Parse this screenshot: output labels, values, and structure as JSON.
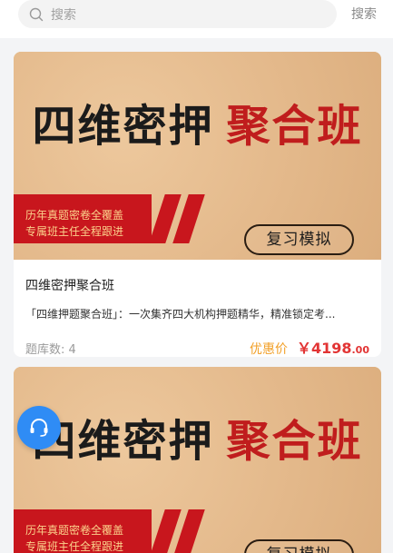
{
  "search": {
    "placeholder": "搜索",
    "button_label": "搜索"
  },
  "courses": [
    {
      "banner": {
        "title_main": "四维密押",
        "title_accent": "聚合班",
        "tag_line1": "历年真题密卷全覆盖",
        "tag_line2": "专属班主任全程跟进",
        "cta_label": "复习模拟"
      },
      "name": "四维密押聚合班",
      "description": "「四维押题聚合班」：一次集齐四大机构押题精华，精准锁定考...",
      "count_label": "题库数: 4",
      "price_label": "优惠价",
      "price_currency": "￥",
      "price_integer": "4198",
      "price_decimal": ".00"
    },
    {
      "banner": {
        "title_main": "四维密押",
        "title_accent": "聚合班",
        "tag_line1": "历年真题密卷全覆盖",
        "tag_line2": "专属班主任全程跟进",
        "cta_label": "复习模拟"
      }
    }
  ],
  "colors": {
    "accent_red": "#c8161d",
    "price_red": "#e23434",
    "price_label_orange": "#f2a028",
    "float_blue": "#2f8cf5"
  },
  "icons": {
    "search": "search-icon",
    "support": "headset-icon"
  }
}
